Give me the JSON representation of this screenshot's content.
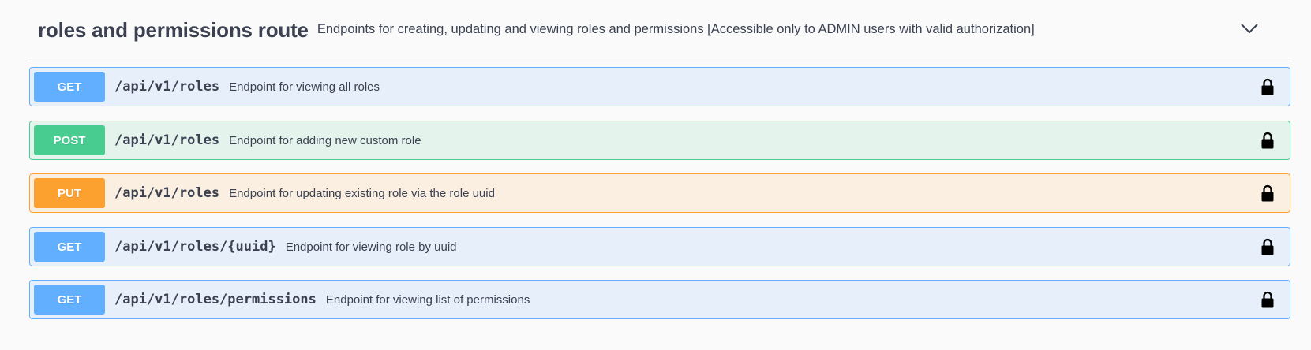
{
  "section": {
    "title": "roles and permissions route",
    "description": "Endpoints for creating, updating and viewing roles and permissions [Accessible only to ADMIN users with valid authorization]",
    "toggle_icon": "chevron-down-icon"
  },
  "operations": [
    {
      "method": "GET",
      "path": "/api/v1/roles",
      "summary": "Endpoint for viewing all roles",
      "icon": "lock-icon"
    },
    {
      "method": "POST",
      "path": "/api/v1/roles",
      "summary": "Endpoint for adding new custom role",
      "icon": "lock-icon"
    },
    {
      "method": "PUT",
      "path": "/api/v1/roles",
      "summary": "Endpoint for updating existing role via the role uuid",
      "icon": "lock-icon"
    },
    {
      "method": "GET",
      "path": "/api/v1/roles/{uuid}",
      "summary": "Endpoint for viewing role by uuid",
      "icon": "lock-icon"
    },
    {
      "method": "GET",
      "path": "/api/v1/roles/permissions",
      "summary": "Endpoint for viewing list of permissions",
      "icon": "lock-icon"
    }
  ],
  "colors": {
    "get": "#61affe",
    "post": "#49cc90",
    "put": "#fca130",
    "text": "#3b4151"
  }
}
